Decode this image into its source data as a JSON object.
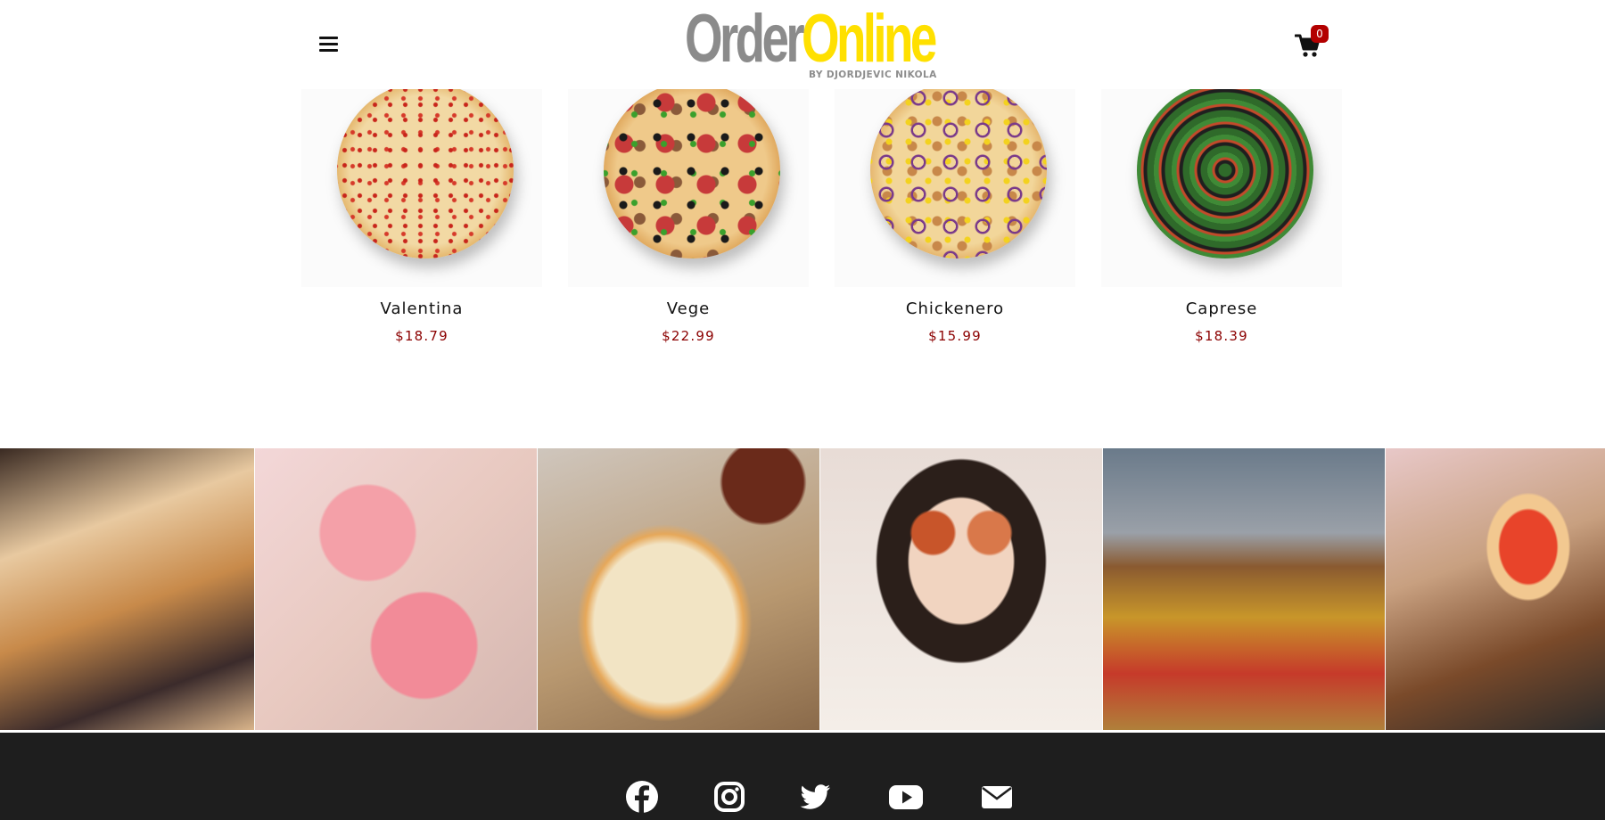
{
  "header": {
    "logo_part1": "Order",
    "logo_part2": "Online",
    "logo_tagline": "BY DJORDJEVIC NIKOLA",
    "cart_count": "0",
    "menu_icon": "hamburger-menu-icon",
    "cart_icon": "shopping-cart-icon"
  },
  "products": [
    {
      "name": "Valentina",
      "price": "$18.79"
    },
    {
      "name": "Vege",
      "price": "$22.99"
    },
    {
      "name": "Chickenero",
      "price": "$15.99"
    },
    {
      "name": "Caprese",
      "price": "$18.39"
    }
  ],
  "gallery": {
    "photos": [
      "pizza-sharing-photo",
      "pink-plates-pizza-photo",
      "pizza-and-wings-photo",
      "woman-with-wings-photo",
      "pizza-boxes-table-photo",
      "man-eating-pizza-photo"
    ]
  },
  "footer": {
    "social_icons": [
      "facebook-icon",
      "instagram-icon",
      "twitter-icon",
      "youtube-icon",
      "email-icon"
    ]
  },
  "colors": {
    "accent_yellow": "#ffe000",
    "logo_gray": "#8b8b8b",
    "price_red": "#8b0000",
    "badge_red": "#b30000",
    "footer_bg": "#1e1e1e"
  }
}
